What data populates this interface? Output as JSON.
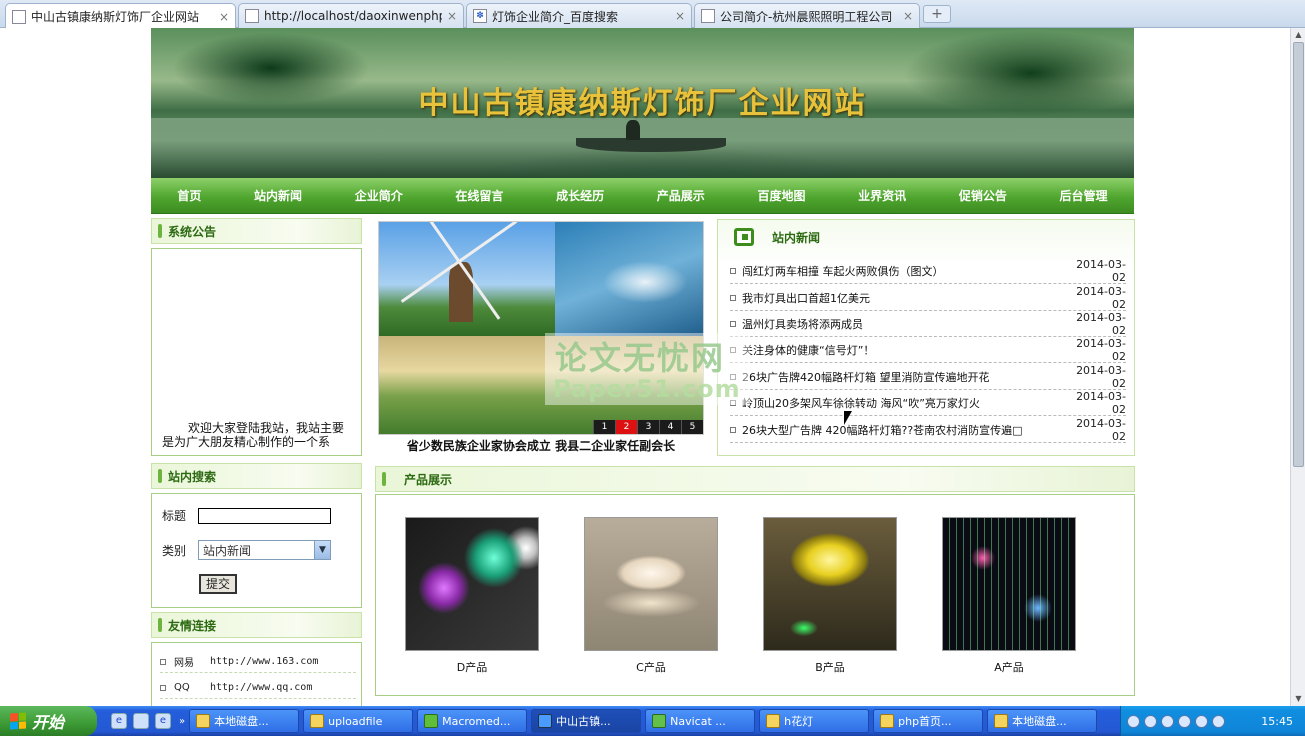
{
  "browser": {
    "tabs": [
      {
        "title": "中山古镇康纳斯灯饰厂企业网站",
        "active": true
      },
      {
        "title": "http://localhost/daoxinwenphp.ph",
        "active": false
      },
      {
        "title": "灯饰企业简介_百度搜索",
        "active": false
      },
      {
        "title": "公司简介-杭州晨熙照明工程公司",
        "active": false
      }
    ],
    "new_tab": "+",
    "close_glyph": "×"
  },
  "site": {
    "title": "中山古镇康纳斯灯饰厂企业网站"
  },
  "nav": [
    "首页",
    "站内新闻",
    "企业简介",
    "在线留言",
    "成长经历",
    "产品展示",
    "百度地图",
    "业界资讯",
    "促销公告",
    "后台管理"
  ],
  "notice": {
    "heading": "系统公告",
    "text": "欢迎大家登陆我站，我站主要是为广大朋友精心制作的一个系"
  },
  "search": {
    "heading": "站内搜索",
    "title_label": "标题",
    "title_value": "",
    "category_label": "类别",
    "category_value": "站内新闻",
    "submit_label": "提交"
  },
  "links": {
    "heading": "友情连接",
    "items": [
      {
        "name": "网易",
        "url": "http://www.163.com"
      },
      {
        "name": "QQ",
        "url": "http://www.qq.com"
      }
    ]
  },
  "slideshow": {
    "caption": "省少数民族企业家协会成立 我县二企业家任副会长",
    "pages": [
      "1",
      "2",
      "3",
      "4",
      "5"
    ],
    "active_page": 2
  },
  "news": {
    "heading": "站内新闻",
    "items": [
      {
        "title": "闯红灯两车相撞 车起火两败俱伤（图文）",
        "date": "2014-03-02"
      },
      {
        "title": "我市灯具出口首超1亿美元",
        "date": "2014-03-02"
      },
      {
        "title": "温州灯具卖场将添两成员",
        "date": "2014-03-02"
      },
      {
        "title": "关注身体的健康“信号灯”！",
        "date": "2014-03-02"
      },
      {
        "title": "26块广告牌420幅路杆灯箱 望里消防宣传遍地开花",
        "date": "2014-03-02"
      },
      {
        "title": "岭顶山20多架风车徐徐转动 海风“吹”亮万家灯火",
        "date": "2014-03-02"
      },
      {
        "title": "26块大型广告牌 420幅路杆灯箱??苍南农村消防宣传遍□",
        "date": "2014-03-02"
      }
    ]
  },
  "products": {
    "heading": "产品展示",
    "items": [
      {
        "name": "D产品"
      },
      {
        "name": "C产品"
      },
      {
        "name": "B产品"
      },
      {
        "name": "A产品"
      }
    ]
  },
  "watermark": {
    "line1": "论文无忧网",
    "line2": "Paper51.com"
  },
  "taskbar": {
    "start_label": "开始",
    "overflow": "»",
    "tasks": [
      {
        "label": "本地磁盘...",
        "active": false
      },
      {
        "label": "uploadfile",
        "active": false
      },
      {
        "label": "Macromed...",
        "active": false
      },
      {
        "label": "中山古镇...",
        "active": true
      },
      {
        "label": "Navicat ...",
        "active": false
      },
      {
        "label": "h花灯",
        "active": false
      },
      {
        "label": "php首页...",
        "active": false
      },
      {
        "label": "本地磁盘...",
        "active": false
      }
    ],
    "clock": "15:45"
  },
  "colors": {
    "nav_green": "#4fa62e",
    "title_gold": "#e8c23a",
    "heading_green": "#2c6a12",
    "active_slide": "#dd1111"
  }
}
